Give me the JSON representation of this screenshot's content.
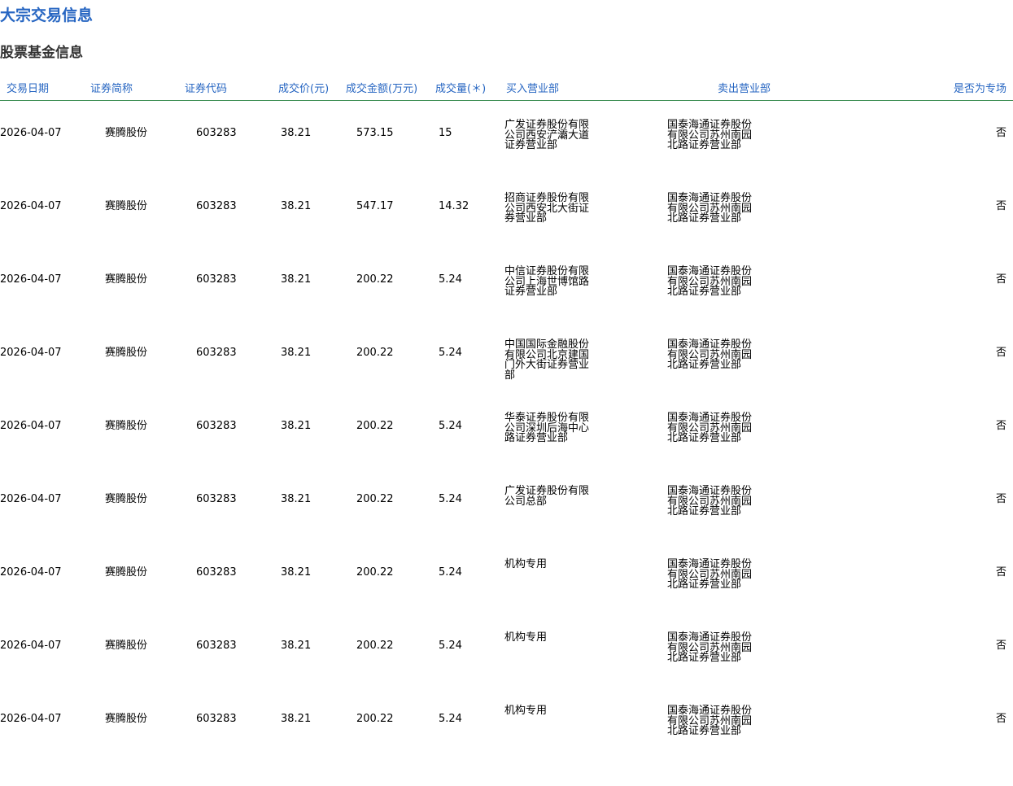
{
  "page": {
    "title": "大宗交易信息",
    "section_title": "股票基金信息"
  },
  "table": {
    "headers": {
      "date": "交易日期",
      "name": "证券简称",
      "code": "证券代码",
      "price": "成交价(元)",
      "amount": "成交金额(万元)",
      "volume": "成交量(＊)",
      "buyer": "买入营业部",
      "seller": "卖出营业部",
      "special": "是否为专场"
    },
    "rows": [
      {
        "date": "2026-04-07",
        "name": "赛腾股份",
        "code": "603283",
        "price": "38.21",
        "amount": "573.15",
        "volume": "15",
        "buyer": "广发证券股份有限公司西安浐灞大道证券营业部",
        "seller": "国泰海通证券股份有限公司苏州南园北路证券营业部",
        "special": "否"
      },
      {
        "date": "2026-04-07",
        "name": "赛腾股份",
        "code": "603283",
        "price": "38.21",
        "amount": "547.17",
        "volume": "14.32",
        "buyer": "招商证券股份有限公司西安北大街证券营业部",
        "seller": "国泰海通证券股份有限公司苏州南园北路证券营业部",
        "special": "否"
      },
      {
        "date": "2026-04-07",
        "name": "赛腾股份",
        "code": "603283",
        "price": "38.21",
        "amount": "200.22",
        "volume": "5.24",
        "buyer": "中信证券股份有限公司上海世博馆路证券营业部",
        "seller": "国泰海通证券股份有限公司苏州南园北路证券营业部",
        "special": "否"
      },
      {
        "date": "2026-04-07",
        "name": "赛腾股份",
        "code": "603283",
        "price": "38.21",
        "amount": "200.22",
        "volume": "5.24",
        "buyer": "中国国际金融股份有限公司北京建国门外大街证券营业部",
        "seller": "国泰海通证券股份有限公司苏州南园北路证券营业部",
        "special": "否"
      },
      {
        "date": "2026-04-07",
        "name": "赛腾股份",
        "code": "603283",
        "price": "38.21",
        "amount": "200.22",
        "volume": "5.24",
        "buyer": "华泰证券股份有限公司深圳后海中心路证券营业部",
        "seller": "国泰海通证券股份有限公司苏州南园北路证券营业部",
        "special": "否"
      },
      {
        "date": "2026-04-07",
        "name": "赛腾股份",
        "code": "603283",
        "price": "38.21",
        "amount": "200.22",
        "volume": "5.24",
        "buyer": "广发证券股份有限公司总部",
        "seller": "国泰海通证券股份有限公司苏州南园北路证券营业部",
        "special": "否"
      },
      {
        "date": "2026-04-07",
        "name": "赛腾股份",
        "code": "603283",
        "price": "38.21",
        "amount": "200.22",
        "volume": "5.24",
        "buyer": "机构专用",
        "seller": "国泰海通证券股份有限公司苏州南园北路证券营业部",
        "special": "否"
      },
      {
        "date": "2026-04-07",
        "name": "赛腾股份",
        "code": "603283",
        "price": "38.21",
        "amount": "200.22",
        "volume": "5.24",
        "buyer": "机构专用",
        "seller": "国泰海通证券股份有限公司苏州南园北路证券营业部",
        "special": "否"
      },
      {
        "date": "2026-04-07",
        "name": "赛腾股份",
        "code": "603283",
        "price": "38.21",
        "amount": "200.22",
        "volume": "5.24",
        "buyer": "机构专用",
        "seller": "国泰海通证券股份有限公司苏州南园北路证券营业部",
        "special": "否"
      }
    ]
  },
  "colors": {
    "accent": "#2766c2",
    "divider": "#3f8f55"
  }
}
